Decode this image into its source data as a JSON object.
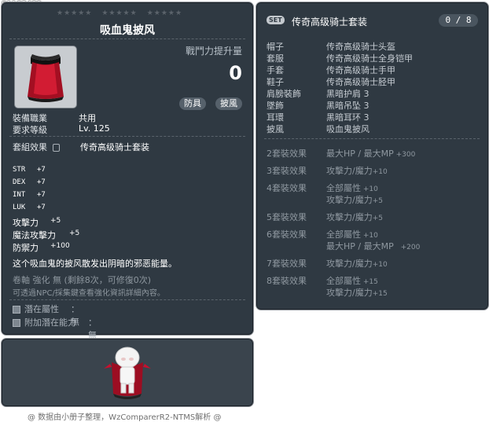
{
  "item_id": "01102489",
  "item": {
    "name": "吸血鬼披风",
    "power_label": "戰鬥力提升量",
    "power_value": "0",
    "chips": [
      "防具",
      "披風"
    ],
    "job_label": "裝備職業",
    "job_value": "共用",
    "level_label": "要求等級",
    "level_value": "Lv. 125",
    "set_label": "套組效果",
    "set_value": "传奇高级骑士套装",
    "stats": [
      {
        "name": "STR",
        "value": "+7"
      },
      {
        "name": "DEX",
        "value": "+7"
      },
      {
        "name": "INT",
        "value": "+7"
      },
      {
        "name": "LUK",
        "value": "+7"
      }
    ],
    "stats2": [
      {
        "name": "攻擊力",
        "value": "+5"
      },
      {
        "name": "魔法攻擊力",
        "value": "+5"
      },
      {
        "name": "防禦力",
        "value": "+100"
      }
    ],
    "description": "这个吸血鬼的披风散发出阴暗的邪恶能量。",
    "upgrade_line": "卷軸 強化 無 (剩餘8次，可修復0次)",
    "hint_line": "可透過NPC/採集鍵查看強化資訊詳細內容。",
    "potential_label": "潛在屬性",
    "potential_value": "：無",
    "bonus_label": "附加潛在能力",
    "bonus_value": "：無"
  },
  "set": {
    "badge": "SET",
    "name": "传奇高级骑士套装",
    "count": "0 / 8",
    "pieces": [
      {
        "slot": "帽子",
        "name": "传奇高级骑士头盔"
      },
      {
        "slot": "套服",
        "name": "传奇高级骑士全身铠甲"
      },
      {
        "slot": "手套",
        "name": "传奇高级骑士手甲"
      },
      {
        "slot": "鞋子",
        "name": "传奇高级骑士胫甲"
      },
      {
        "slot": "肩膀裝飾",
        "name": "黑暗护肩 3"
      },
      {
        "slot": "墜飾",
        "name": "黑暗吊坠 3"
      },
      {
        "slot": "耳環",
        "name": "黑暗耳环 3"
      },
      {
        "slot": "披風",
        "name": "吸血鬼披风"
      }
    ],
    "effects": [
      {
        "label": "2套裝效果",
        "lines": [
          {
            "text": "最大HP / 最大MP",
            "value": " +300"
          }
        ]
      },
      {
        "label": "3套裝效果",
        "lines": [
          {
            "text": "攻擊力/魔力",
            "value": "+10"
          }
        ]
      },
      {
        "label": "4套裝效果",
        "lines": [
          {
            "text": "全部屬性",
            "value": " +10"
          },
          {
            "text": "攻擊力/魔力",
            "value": "+5"
          }
        ]
      },
      {
        "label": "5套裝效果",
        "lines": [
          {
            "text": "攻擊力/魔力",
            "value": "+5"
          }
        ]
      },
      {
        "label": "6套裝效果",
        "lines": [
          {
            "text": "全部屬性",
            "value": " +10"
          },
          {
            "text": "最大HP / 最大MP",
            "value": " +200"
          }
        ]
      },
      {
        "label": "7套裝效果",
        "lines": [
          {
            "text": "攻擊力/魔力",
            "value": "+10"
          }
        ]
      },
      {
        "label": "8套裝效果",
        "lines": [
          {
            "text": "全部屬性",
            "value": " +15"
          },
          {
            "text": "攻擊力/魔力",
            "value": "+15"
          }
        ]
      }
    ]
  },
  "footer": "@ 数据由小册子整理，WzComparerR2-NTMS解析 @",
  "colors": {
    "panel": "#2f3942",
    "border": "#8c9197",
    "cape_red": "#c8102e",
    "text": "#ffffff",
    "dim": "#8d969e"
  }
}
